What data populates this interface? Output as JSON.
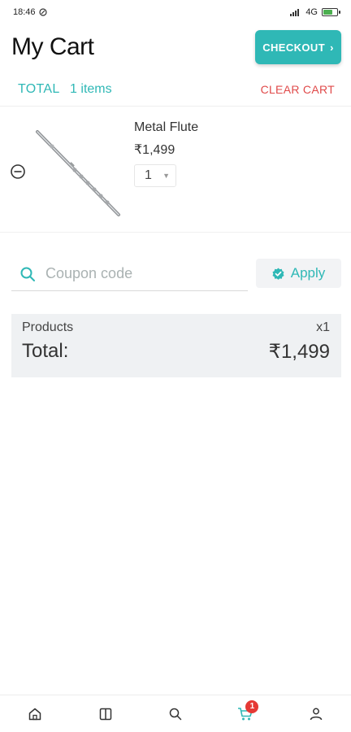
{
  "status_bar": {
    "time": "18:46",
    "network": "4G"
  },
  "header": {
    "title": "My Cart",
    "checkout_label": "CHECKOUT",
    "checkout_arrow": "›"
  },
  "summary": {
    "total_label": "TOTAL",
    "items_count": "1 items",
    "clear_cart_label": "CLEAR CART"
  },
  "cart_items": [
    {
      "name": "Metal Flute",
      "price": "₹1,499",
      "quantity": "1"
    }
  ],
  "coupon": {
    "placeholder": "Coupon code",
    "apply_label": "Apply"
  },
  "totals": {
    "products_label": "Products",
    "products_count": "x1",
    "total_label": "Total:",
    "total_value": "₹1,499"
  },
  "bottom_nav": {
    "items": [
      {
        "name": "home",
        "icon": "home-icon"
      },
      {
        "name": "catalog",
        "icon": "book-icon"
      },
      {
        "name": "search",
        "icon": "search-icon"
      },
      {
        "name": "cart",
        "icon": "cart-icon",
        "badge": "1"
      },
      {
        "name": "profile",
        "icon": "user-icon"
      }
    ]
  },
  "colors": {
    "accent": "#2fb8b6",
    "danger": "#e04a4a",
    "badge": "#e53935",
    "panel": "#eff1f3"
  }
}
